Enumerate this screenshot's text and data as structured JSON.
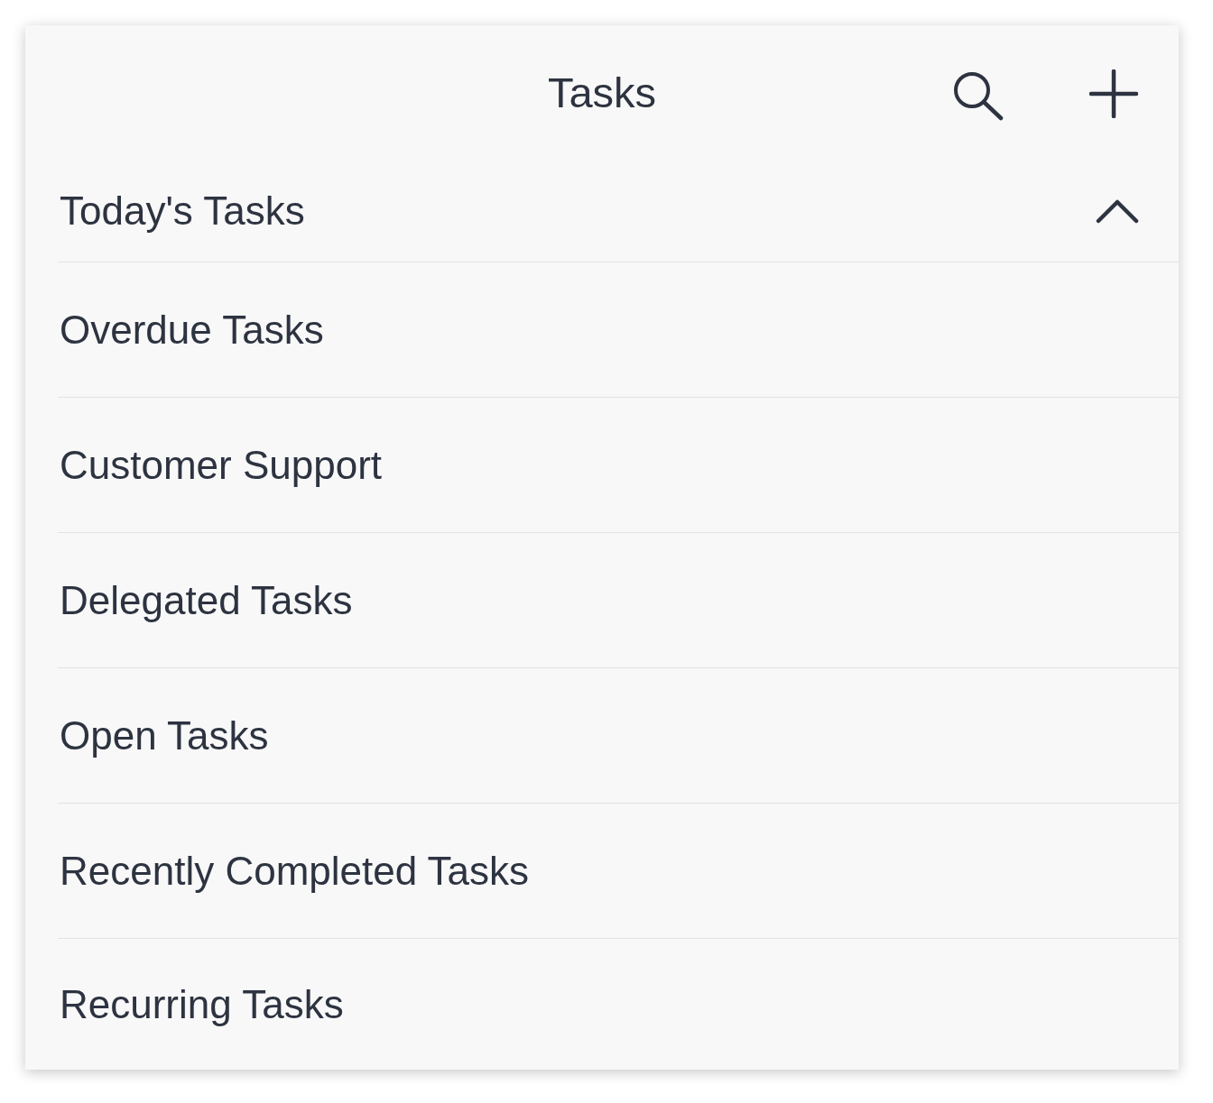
{
  "header": {
    "title": "Tasks"
  },
  "section": {
    "title": "Today's Tasks",
    "expanded": true
  },
  "items": [
    {
      "label": "Overdue Tasks"
    },
    {
      "label": "Customer Support"
    },
    {
      "label": "Delegated Tasks"
    },
    {
      "label": "Open Tasks"
    },
    {
      "label": "Recently Completed Tasks"
    },
    {
      "label": "Recurring Tasks"
    }
  ]
}
